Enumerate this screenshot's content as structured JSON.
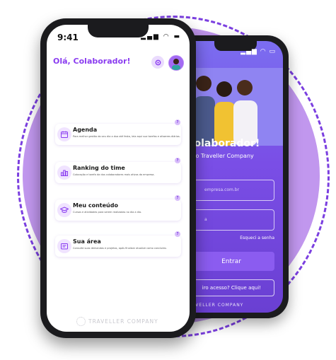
{
  "front": {
    "time": "9:41",
    "greeting": "Olá, Colaborador!",
    "cards": [
      {
        "title": "Agenda",
        "desc": "Para melhor gestão do seu dia a dua até festa, leia aqui sua tarefas e afazeres diários.",
        "help": "?"
      },
      {
        "title": "Ranking do time",
        "desc": "Colocação e tarefa da dos colaboradores mais ativos da empresa.",
        "help": "?"
      },
      {
        "title": "Meu conteúdo",
        "desc": "Cursos e atividades para serem realizadas no dia a dia.",
        "help": "?"
      },
      {
        "title": "Sua área",
        "desc": "Consulte suas demandas e projetos, após finalizar atualize como concluído.",
        "help": "?"
      }
    ],
    "brand": "TRAVELLER COMPANY"
  },
  "back": {
    "title": ", Colaborador!",
    "subtitle": "ndo ao Traveller Company",
    "email_placeholder": "empresa.com.br",
    "password_placeholder": "a",
    "forgot": "Esqueci a senha",
    "enter": "Entrar",
    "first_access": "iro acesso? Clique aqui!",
    "brand": "TRAVELLER COMPANY"
  },
  "colors": {
    "accent": "#8a3cf0",
    "circle": "#c197ee",
    "dash": "#7b3fe0"
  }
}
